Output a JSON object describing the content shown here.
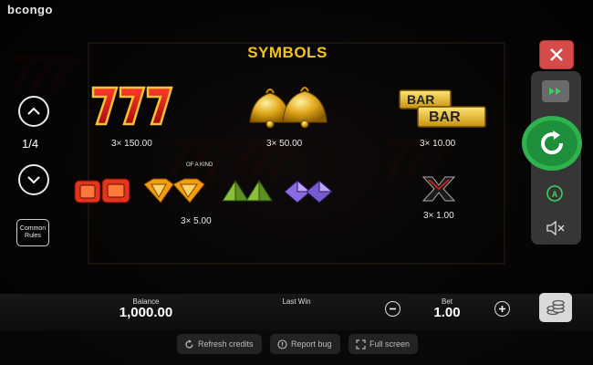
{
  "logo": "bcongo",
  "title": "SYMBOLS",
  "page_indicator": "1/4",
  "common_rules": "Common Rules",
  "of_a_kind": "OF A KIND",
  "symbols": [
    {
      "name": "seven",
      "payout": "3×  150.00"
    },
    {
      "name": "bells",
      "payout": "3×  50.00"
    },
    {
      "name": "bar-bar",
      "payout": "3×  10.00",
      "text1": "BAR",
      "text2": "BAR"
    },
    {
      "name": "red-gems",
      "payout": ""
    },
    {
      "name": "gems",
      "payout": "3×  5.00"
    },
    {
      "name": "cross",
      "payout": "3×  1.00"
    }
  ],
  "bottom": {
    "balance_label": "Balance",
    "balance_value": "1,000.00",
    "last_win_label": "Last Win",
    "bet_label": "Bet",
    "bet_value": "1.00"
  },
  "footer": {
    "refresh": "Refresh credits",
    "report": "Report bug",
    "fullscreen": "Full screen"
  },
  "colors": {
    "accent": "#f2c31b",
    "spin": "#2fb34f",
    "close": "#d64a4a"
  },
  "icons": [
    "close-icon",
    "fast-forward-icon",
    "spin-icon",
    "autoplay-icon",
    "mute-icon",
    "chevron-up-icon",
    "chevron-down-icon",
    "minus-icon",
    "plus-icon",
    "coins-icon",
    "refresh-icon",
    "alert-icon",
    "fullscreen-icon"
  ]
}
